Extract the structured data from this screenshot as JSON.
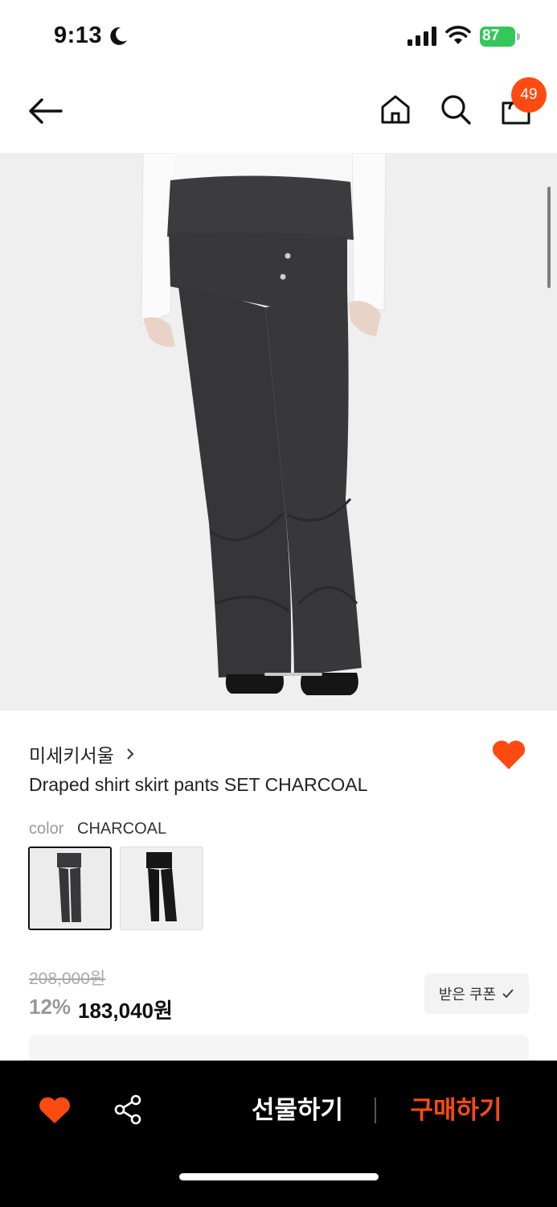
{
  "status_bar": {
    "time": "9:13",
    "battery": "87"
  },
  "header": {
    "cart_count": "49"
  },
  "product": {
    "brand": "미세키서울",
    "name": "Draped shirt skirt pants SET CHARCOAL",
    "color_label": "color",
    "color_value": "CHARCOAL",
    "original_price": "208,000원",
    "discount": "12%",
    "sale_price": "183,040원",
    "coupon_label": "받은 쿠폰"
  },
  "bottom_bar": {
    "gift_label": "선물하기",
    "buy_label": "구매하기"
  },
  "colors": {
    "accent": "#ff4b11",
    "battery": "#34c759"
  }
}
